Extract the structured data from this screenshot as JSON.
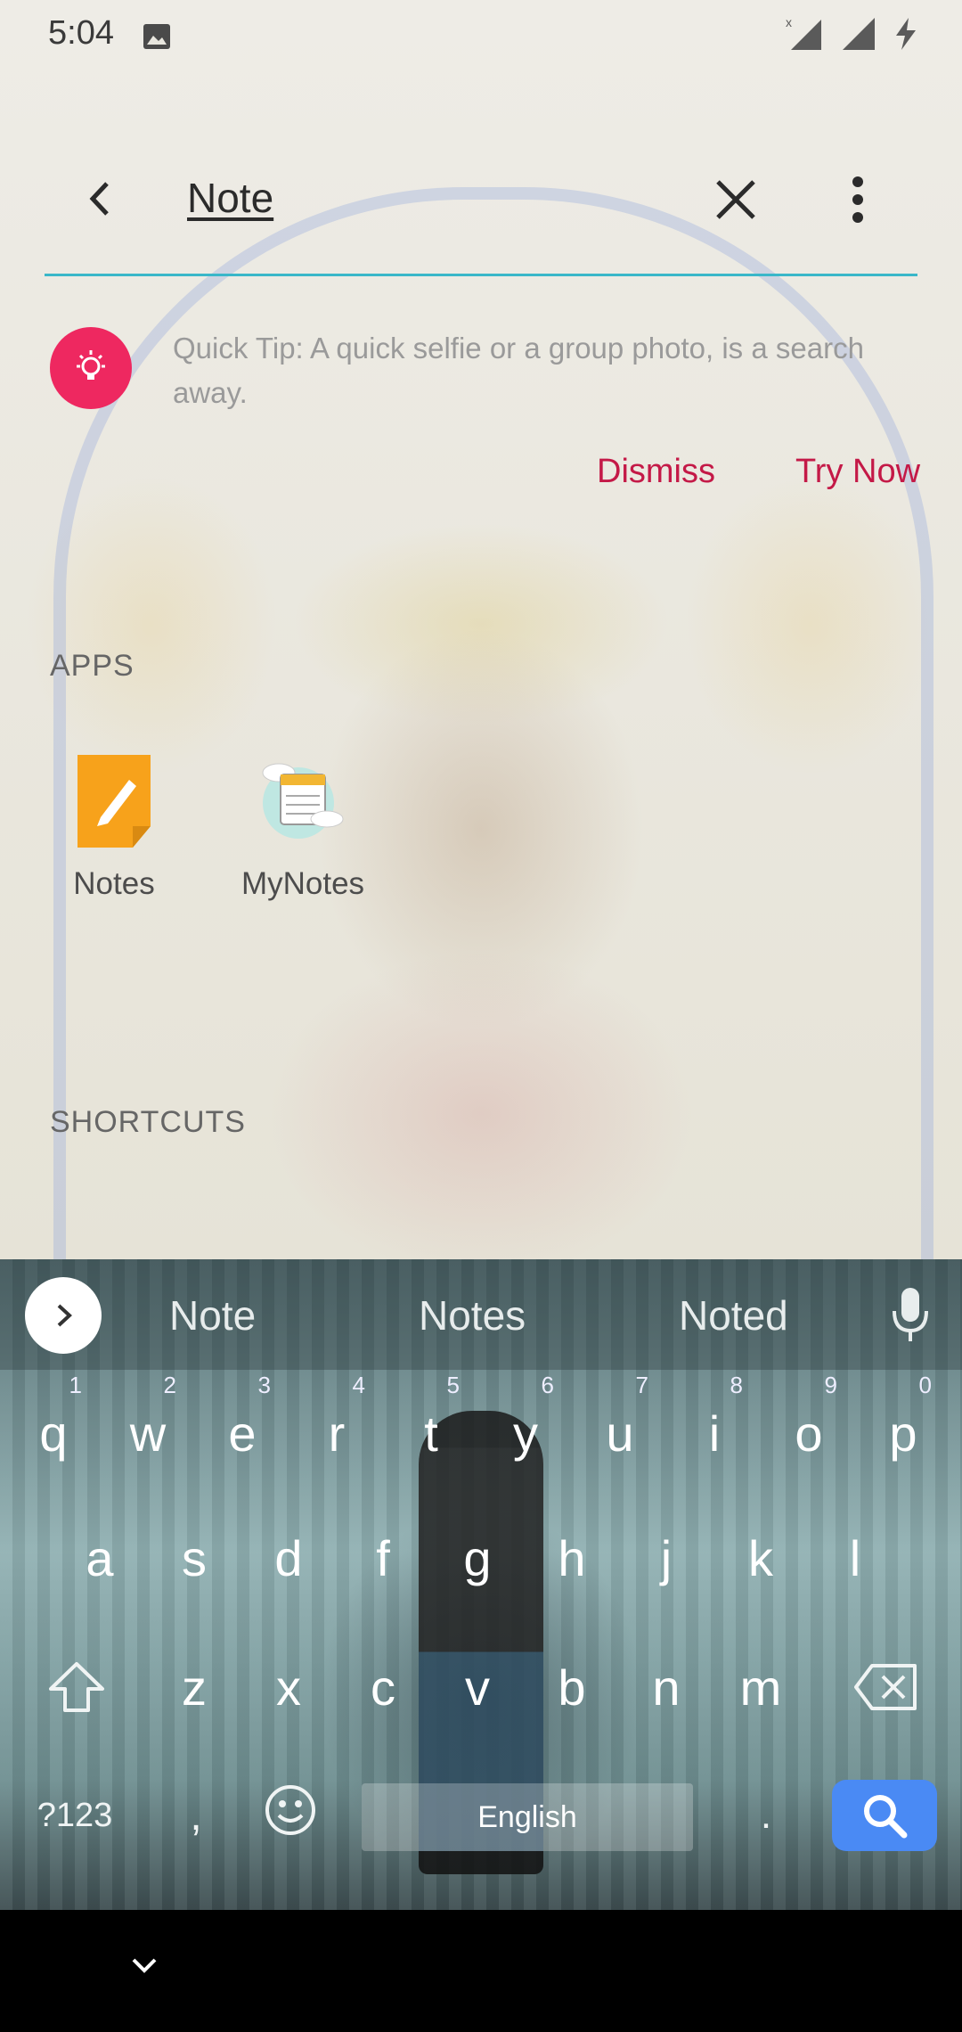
{
  "status": {
    "time": "5:04",
    "icons": [
      "image-icon",
      "signal-off-icon",
      "signal-icon",
      "charging-icon"
    ]
  },
  "search": {
    "query": "Note"
  },
  "quick_tip": {
    "text": "Quick Tip: A quick selfie or a group photo, is a search away.",
    "dismiss_label": "Dismiss",
    "try_label": "Try Now",
    "accent_color": "#ee2860"
  },
  "sections": {
    "apps_label": "APPS",
    "shortcuts_label": "SHORTCUTS"
  },
  "apps": [
    {
      "name": "Notes",
      "icon": "notes-app-icon"
    },
    {
      "name": "MyNotes",
      "icon": "mynotes-app-icon"
    }
  ],
  "keyboard": {
    "suggestions": [
      "Note",
      "Notes",
      "Noted"
    ],
    "row1": [
      {
        "key": "q",
        "num": "1"
      },
      {
        "key": "w",
        "num": "2"
      },
      {
        "key": "e",
        "num": "3"
      },
      {
        "key": "r",
        "num": "4"
      },
      {
        "key": "t",
        "num": "5"
      },
      {
        "key": "y",
        "num": "6"
      },
      {
        "key": "u",
        "num": "7"
      },
      {
        "key": "i",
        "num": "8"
      },
      {
        "key": "o",
        "num": "9"
      },
      {
        "key": "p",
        "num": "0"
      }
    ],
    "row2": [
      "a",
      "s",
      "d",
      "f",
      "g",
      "h",
      "j",
      "k",
      "l"
    ],
    "row3": [
      "z",
      "x",
      "c",
      "v",
      "b",
      "n",
      "m"
    ],
    "symbols_label": "?123",
    "comma_label": ",",
    "period_label": ".",
    "space_label": "English",
    "search_key_color": "#4a8af4"
  }
}
